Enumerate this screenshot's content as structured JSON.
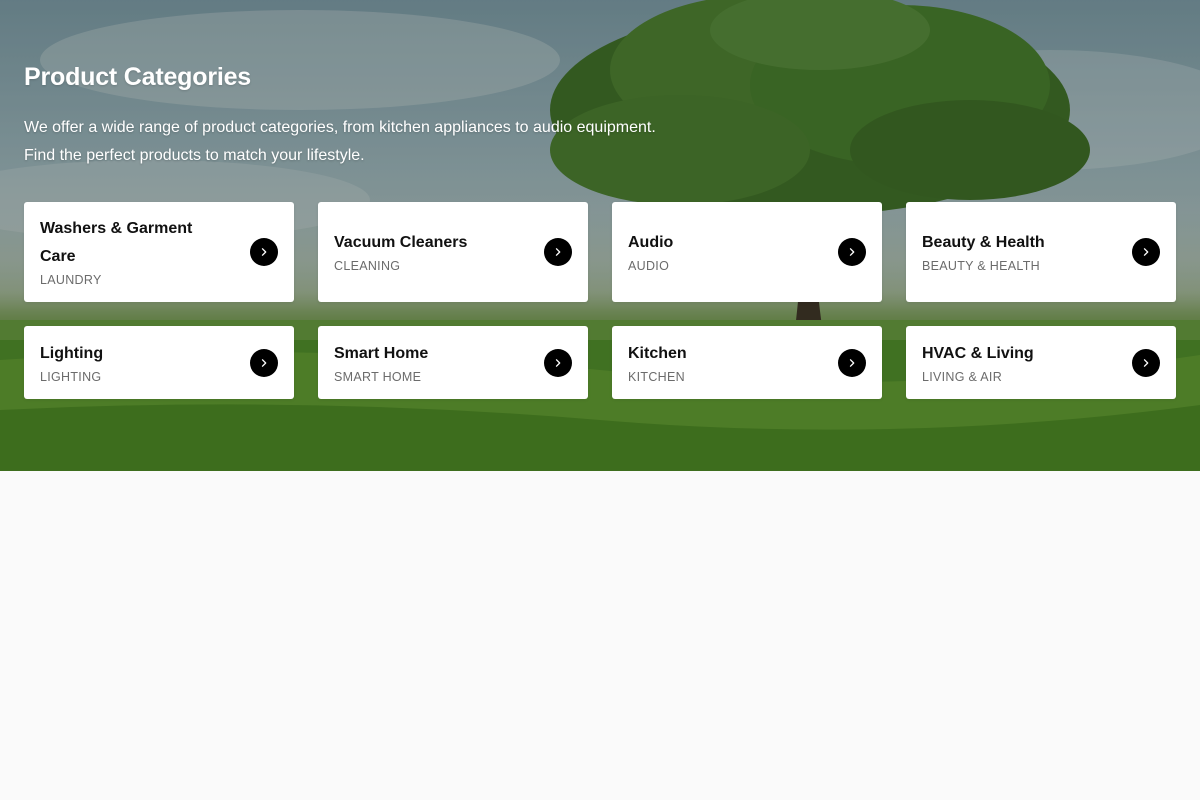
{
  "hero": {
    "title": "Product Categories",
    "description_line1": "We offer a wide range of product categories, from kitchen appliances to audio equipment.",
    "description_line2": "Find the perfect products to match your lifestyle."
  },
  "categories": [
    {
      "name": "Washers & Garment Care",
      "subtitle": "LAUNDRY"
    },
    {
      "name": "Vacuum Cleaners",
      "subtitle": "CLEANING"
    },
    {
      "name": "Audio",
      "subtitle": "AUDIO"
    },
    {
      "name": "Beauty & Health",
      "subtitle": "BEAUTY & HEALTH"
    },
    {
      "name": "Lighting",
      "subtitle": "LIGHTING"
    },
    {
      "name": "Smart Home",
      "subtitle": "SMART HOME"
    },
    {
      "name": "Kitchen",
      "subtitle": "KITCHEN"
    },
    {
      "name": "HVAC & Living",
      "subtitle": "LIVING & AIR"
    }
  ],
  "icons": {
    "card_arrow": "chevron-right-icon",
    "background": "tree-field-background"
  },
  "colors": {
    "card_background": "#ffffff",
    "arrow_button": "#000000",
    "page_background": "#fafafa",
    "subtitle_text": "#6b6b6b"
  }
}
